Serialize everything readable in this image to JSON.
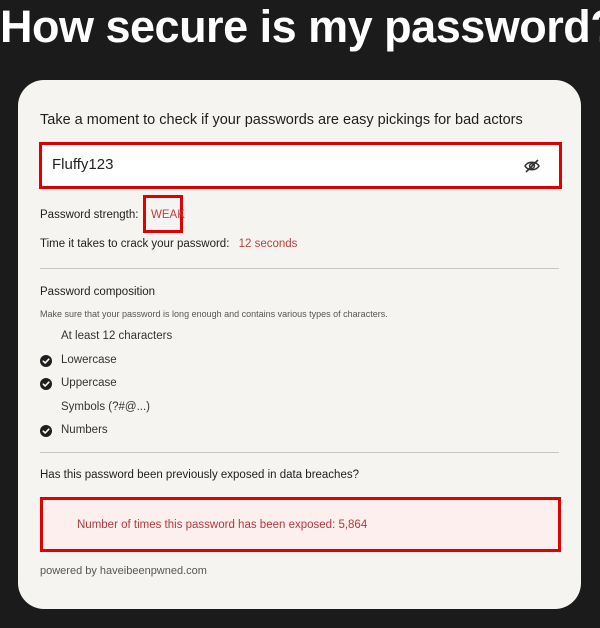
{
  "header": {
    "title": "How secure is my password?"
  },
  "card": {
    "intro": "Take a moment to check if your passwords are easy pickings for bad actors",
    "password_input": {
      "value": "Fluffy123",
      "toggle_icon": "eye-slash-icon"
    },
    "strength": {
      "label": "Password strength:",
      "value": "WEAK"
    },
    "crack_time": {
      "label": "Time it takes to crack your password:",
      "value": "12 seconds"
    },
    "composition": {
      "heading": "Password composition",
      "note": "Make sure that your password is long enough and contains various types of characters.",
      "items": [
        {
          "label": "At least 12 characters",
          "met": false
        },
        {
          "label": "Lowercase",
          "met": true
        },
        {
          "label": "Uppercase",
          "met": true
        },
        {
          "label": "Symbols (?#@...)",
          "met": false
        },
        {
          "label": "Numbers",
          "met": true
        }
      ]
    },
    "breach": {
      "heading": "Has this password been previously exposed in data breaches?",
      "result": "Number of times this password has been exposed: 5,864"
    },
    "powered_by": "powered by haveibeenpwned.com"
  },
  "colors": {
    "page_bg": "#1b1b1b",
    "card_bg": "#f6f4f1",
    "highlight_border": "#e00000",
    "warning_text": "#c43b3b",
    "breach_bg": "#fcefee"
  }
}
